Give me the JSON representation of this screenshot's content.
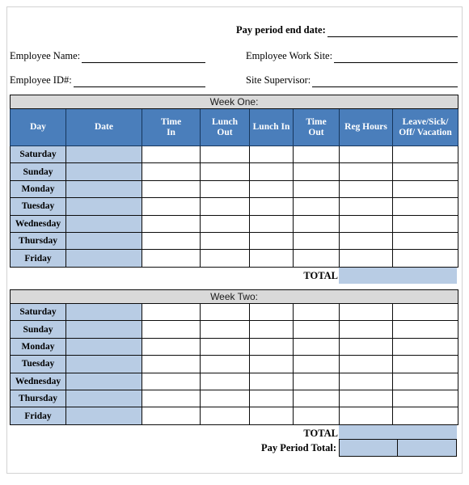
{
  "header": {
    "pay_period_end_label": "Pay period end date:",
    "employee_name_label": "Employee Name:",
    "employee_work_site_label": "Employee Work Site:",
    "employee_id_label": "Employee ID#:",
    "site_supervisor_label": "Site Supervisor:",
    "pay_period_end_value": "",
    "employee_name_value": "",
    "employee_work_site_value": "",
    "employee_id_value": "",
    "site_supervisor_value": ""
  },
  "columns": [
    "Day",
    "Date",
    "Time In",
    "Lunch Out",
    "Lunch In",
    "Time Out",
    "Reg Hours",
    "Leave/Sick/ Off/ Vacation"
  ],
  "column_lines": {
    "day": [
      "Day"
    ],
    "date": [
      "Date"
    ],
    "time_in": [
      "Time",
      "In"
    ],
    "lunch_out": [
      "Lunch",
      "Out"
    ],
    "lunch_in": [
      "Lunch In"
    ],
    "time_out": [
      "Time",
      "Out"
    ],
    "reg_hours": [
      "Reg Hours"
    ],
    "leave": [
      "Leave/Sick/",
      "Off/ Vacation"
    ]
  },
  "week_one": {
    "banner": "Week One:",
    "days": [
      "Saturday",
      "Sunday",
      "Monday",
      "Tuesday",
      "Wednesday",
      "Thursday",
      "Friday"
    ],
    "rows": [
      {
        "day": "Saturday",
        "date": "",
        "time_in": "",
        "lunch_out": "",
        "lunch_in": "",
        "time_out": "",
        "reg_hours": "",
        "leave": ""
      },
      {
        "day": "Sunday",
        "date": "",
        "time_in": "",
        "lunch_out": "",
        "lunch_in": "",
        "time_out": "",
        "reg_hours": "",
        "leave": ""
      },
      {
        "day": "Monday",
        "date": "",
        "time_in": "",
        "lunch_out": "",
        "lunch_in": "",
        "time_out": "",
        "reg_hours": "",
        "leave": ""
      },
      {
        "day": "Tuesday",
        "date": "",
        "time_in": "",
        "lunch_out": "",
        "lunch_in": "",
        "time_out": "",
        "reg_hours": "",
        "leave": ""
      },
      {
        "day": "Wednesday",
        "date": "",
        "time_in": "",
        "lunch_out": "",
        "lunch_in": "",
        "time_out": "",
        "reg_hours": "",
        "leave": ""
      },
      {
        "day": "Thursday",
        "date": "",
        "time_in": "",
        "lunch_out": "",
        "lunch_in": "",
        "time_out": "",
        "reg_hours": "",
        "leave": ""
      },
      {
        "day": "Friday",
        "date": "",
        "time_in": "",
        "lunch_out": "",
        "lunch_in": "",
        "time_out": "",
        "reg_hours": "",
        "leave": ""
      }
    ],
    "total_label": "TOTAL",
    "total_value": ""
  },
  "week_two": {
    "banner": "Week Two:",
    "days": [
      "Saturday",
      "Sunday",
      "Monday",
      "Tuesday",
      "Wednesday",
      "Thursday",
      "Friday"
    ],
    "rows": [
      {
        "day": "Saturday",
        "date": "",
        "time_in": "",
        "lunch_out": "",
        "lunch_in": "",
        "time_out": "",
        "reg_hours": "",
        "leave": ""
      },
      {
        "day": "Sunday",
        "date": "",
        "time_in": "",
        "lunch_out": "",
        "lunch_in": "",
        "time_out": "",
        "reg_hours": "",
        "leave": ""
      },
      {
        "day": "Monday",
        "date": "",
        "time_in": "",
        "lunch_out": "",
        "lunch_in": "",
        "time_out": "",
        "reg_hours": "",
        "leave": ""
      },
      {
        "day": "Tuesday",
        "date": "",
        "time_in": "",
        "lunch_out": "",
        "lunch_in": "",
        "time_out": "",
        "reg_hours": "",
        "leave": ""
      },
      {
        "day": "Wednesday",
        "date": "",
        "time_in": "",
        "lunch_out": "",
        "lunch_in": "",
        "time_out": "",
        "reg_hours": "",
        "leave": ""
      },
      {
        "day": "Thursday",
        "date": "",
        "time_in": "",
        "lunch_out": "",
        "lunch_in": "",
        "time_out": "",
        "reg_hours": "",
        "leave": ""
      },
      {
        "day": "Friday",
        "date": "",
        "time_in": "",
        "lunch_out": "",
        "lunch_in": "",
        "time_out": "",
        "reg_hours": "",
        "leave": ""
      }
    ],
    "total_label": "TOTAL",
    "total_value": ""
  },
  "pay_period_total": {
    "label": "Pay Period Total:",
    "value_left": "",
    "value_right": ""
  },
  "colors": {
    "header_blue": "#4A7EBB",
    "cell_light_blue": "#B8CCE4",
    "banner_gray": "#D9D9D9",
    "border": "#0C0C0C",
    "header_border": "#16365C",
    "page_frame": "#D2D2D2"
  }
}
